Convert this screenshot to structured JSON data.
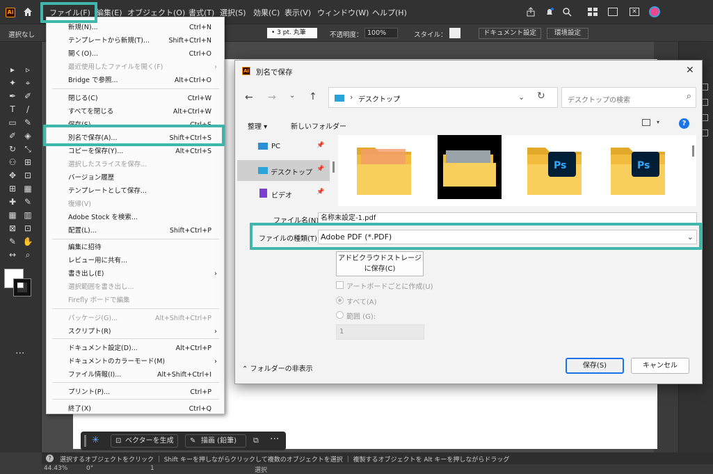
{
  "menubar": {
    "app_badge": "Ai",
    "items": [
      "ファイル(F)",
      "編集(E)",
      "オブジェクト(O)",
      "書式(T)",
      "選択(S)",
      "効果(C)",
      "表示(V)",
      "ウィンドウ(W)",
      "ヘルプ(H)"
    ]
  },
  "control_bar": {
    "selection_label": "選択なし",
    "stroke_profile": "3 pt. 丸筆",
    "opacity_label": "不透明度：",
    "opacity_value": "100%",
    "style_label": "スタイル：",
    "doc_settings": "ドキュメント設定",
    "preferences": "環境設定"
  },
  "file_menu": {
    "items": [
      {
        "label": "新規(N)...",
        "shortcut": "Ctrl+N",
        "disabled": false
      },
      {
        "label": "テンプレートから新規(T)...",
        "shortcut": "Shift+Ctrl+N",
        "disabled": false
      },
      {
        "label": "開く(O)...",
        "shortcut": "Ctrl+O",
        "disabled": false
      },
      {
        "label": "最近使用したファイルを開く(F)",
        "shortcut": "",
        "disabled": true
      },
      {
        "label": "Bridge で参照...",
        "shortcut": "Alt+Ctrl+O",
        "disabled": false
      },
      {
        "label": "閉じる(C)",
        "shortcut": "Ctrl+W",
        "disabled": false
      },
      {
        "label": "すべてを閉じる",
        "shortcut": "Alt+Ctrl+W",
        "disabled": false
      },
      {
        "label": "保存(S)",
        "shortcut": "Ctrl+S",
        "disabled": false
      },
      {
        "label": "別名で保存(A)...",
        "shortcut": "Shift+Ctrl+S",
        "disabled": false
      },
      {
        "label": "コピーを保存(Y)...",
        "shortcut": "Alt+Ctrl+S",
        "disabled": false
      },
      {
        "label": "選択したスライスを保存...",
        "shortcut": "",
        "disabled": true
      },
      {
        "label": "バージョン履歴",
        "shortcut": "",
        "disabled": false
      },
      {
        "label": "テンプレートとして保存...",
        "shortcut": "",
        "disabled": false
      },
      {
        "label": "復帰(V)",
        "shortcut": "",
        "disabled": true
      },
      {
        "label": "Adobe Stock を検索...",
        "shortcut": "",
        "disabled": false
      },
      {
        "label": "配置(L)...",
        "shortcut": "Shift+Ctrl+P",
        "disabled": false
      },
      {
        "label": "編集に招待",
        "shortcut": "",
        "disabled": false
      },
      {
        "label": "レビュー用に共有...",
        "shortcut": "",
        "disabled": false
      },
      {
        "label": "書き出し(E)",
        "shortcut": "",
        "disabled": false
      },
      {
        "label": "選択範囲を書き出し...",
        "shortcut": "",
        "disabled": true
      },
      {
        "label": "Firefly ボードで編集",
        "shortcut": "",
        "disabled": true
      },
      {
        "label": "パッケージ(G)...",
        "shortcut": "Alt+Shift+Ctrl+P",
        "disabled": true
      },
      {
        "label": "スクリプト(R)",
        "shortcut": "",
        "disabled": false
      },
      {
        "label": "ドキュメント設定(D)...",
        "shortcut": "Alt+Ctrl+P",
        "disabled": false
      },
      {
        "label": "ドキュメントのカラーモード(M)",
        "shortcut": "",
        "disabled": false
      },
      {
        "label": "ファイル情報(I)...",
        "shortcut": "Alt+Shift+Ctrl+I",
        "disabled": false
      },
      {
        "label": "プリント(P)...",
        "shortcut": "Ctrl+P",
        "disabled": false
      },
      {
        "label": "終了(X)",
        "shortcut": "Ctrl+Q",
        "disabled": false
      }
    ]
  },
  "dialog": {
    "app_badge": "Ai",
    "title": "別名で保存",
    "breadcrumb": "デスクトップ",
    "search_placeholder": "デスクトップの検索",
    "organize": "整理",
    "new_folder": "新しいフォルダー",
    "nav_items": [
      "PC",
      "デスクトップ",
      "ビデオ"
    ],
    "file_name_label": "ファイル名(N):",
    "file_name_value": "名称未設定-1.pdf",
    "file_type_label": "ファイルの種類(T):",
    "file_type_value": "Adobe PDF (*.PDF)",
    "cloud_save": "アドビクラウドストレージに保存(C)",
    "per_artboard": "アートボードごとに作成(U)",
    "all": "すべて(A)",
    "range": "範囲 (G):",
    "range_value": "1",
    "hide_folders": "フォルダーの非表示",
    "save": "保存(S)",
    "cancel": "キャンセル"
  },
  "floating_bar": {
    "vectorize": "ベクターを生成",
    "draw": "描画 (鉛筆)"
  },
  "status": {
    "hint": "選択するオブジェクトをクリック ｜ Shift キーを押しながらクリックして複数のオブジェクトを選択 ｜ 複製するオブジェクトを Alt キーを押しながらドラッグ",
    "zoom": "44.43%",
    "angle": "0°",
    "page": "1",
    "mode": "選択"
  },
  "colors": {
    "highlight": "#3fb7ad",
    "accent": "#1a73e8"
  }
}
